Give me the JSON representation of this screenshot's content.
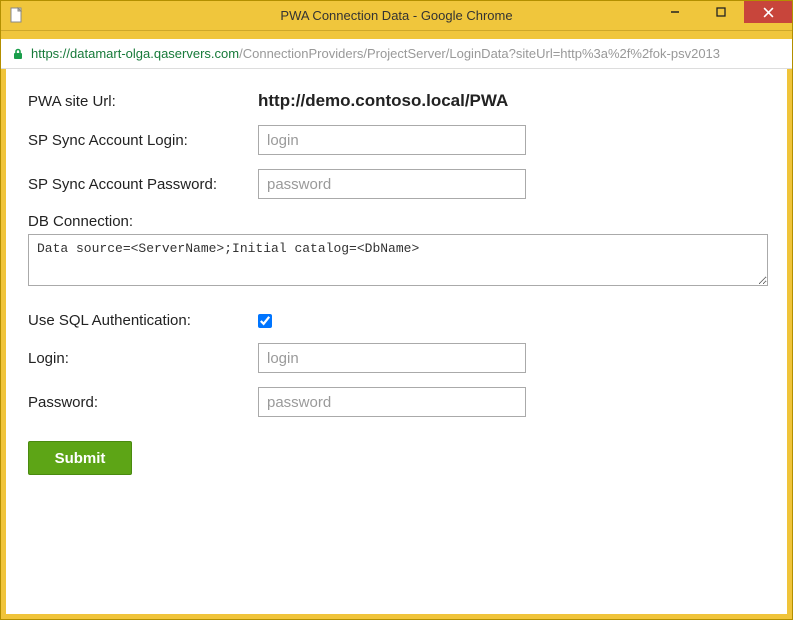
{
  "window": {
    "title": "PWA Connection Data - Google Chrome"
  },
  "url": {
    "scheme": "https://",
    "host": "datamart-olga.qaservers.com",
    "path": "/ConnectionProviders/ProjectServer/LoginData?siteUrl=http%3a%2f%2fok-psv2013"
  },
  "form": {
    "pwa_site_url_label": "PWA site Url:",
    "pwa_site_url_value": "http://demo.contoso.local/PWA",
    "sp_login_label": "SP Sync Account Login:",
    "sp_login_placeholder": "login",
    "sp_password_label": "SP Sync Account Password:",
    "sp_password_placeholder": "password",
    "db_connection_label": "DB Connection:",
    "db_connection_value": "Data source=<ServerName>;Initial catalog=<DbName>",
    "use_sql_auth_label": "Use SQL Authentication:",
    "use_sql_auth_checked": true,
    "login_label": "Login:",
    "login_placeholder": "login",
    "password_label": "Password:",
    "password_placeholder": "password",
    "submit_label": "Submit"
  }
}
